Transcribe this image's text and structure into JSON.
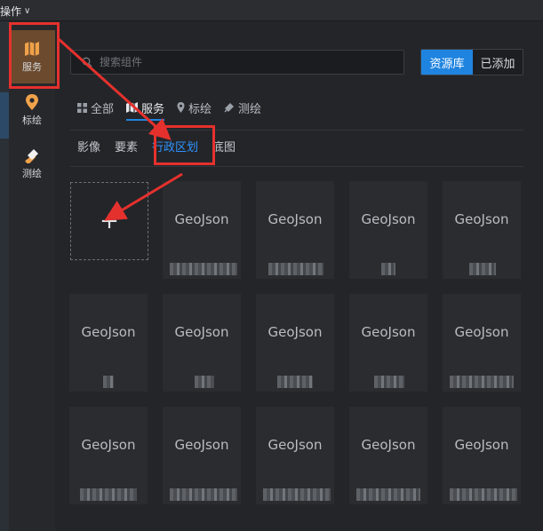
{
  "topbar": {
    "menu_label": "操作",
    "menu_chevron": "∨"
  },
  "sidebar": {
    "items": [
      {
        "label": "服务",
        "icon": "map-folded-icon",
        "active": true
      },
      {
        "label": "标绘",
        "icon": "location-pin-icon",
        "active": false
      },
      {
        "label": "测绘",
        "icon": "ruler-pencil-icon",
        "active": false
      }
    ]
  },
  "search": {
    "placeholder": "搜索组件",
    "icon": "search-icon"
  },
  "segmented": {
    "primary_label": "资源库",
    "secondary_label": "已添加"
  },
  "tabs": [
    {
      "label": "全部",
      "icon": "grid-icon",
      "active": false
    },
    {
      "label": "服务",
      "icon": "map-folded-icon",
      "active": true
    },
    {
      "label": "标绘",
      "icon": "location-pin-icon",
      "active": false
    },
    {
      "label": "测绘",
      "icon": "ruler-pencil-icon",
      "active": false
    }
  ],
  "subtabs": [
    {
      "label": "影像",
      "active": false
    },
    {
      "label": "要素",
      "active": false
    },
    {
      "label": "行政区划",
      "active": true
    },
    {
      "label": "底图",
      "active": false
    }
  ],
  "add_card": {
    "symbol": "+"
  },
  "cards": [
    {
      "label": "GeoJson"
    },
    {
      "label": "GeoJson"
    },
    {
      "label": "GeoJson"
    },
    {
      "label": "GeoJson"
    },
    {
      "label": "GeoJson"
    },
    {
      "label": "GeoJson"
    },
    {
      "label": "GeoJson"
    },
    {
      "label": "GeoJson"
    },
    {
      "label": "GeoJson"
    },
    {
      "label": "GeoJson"
    },
    {
      "label": "GeoJson"
    },
    {
      "label": "GeoJson"
    },
    {
      "label": "GeoJson"
    },
    {
      "label": "GeoJson"
    }
  ],
  "colors": {
    "accent": "#1f84e0",
    "active_sidebar": "#6b4a2e",
    "annotation": "#e5312d",
    "active_subtab": "#2f93ff"
  }
}
